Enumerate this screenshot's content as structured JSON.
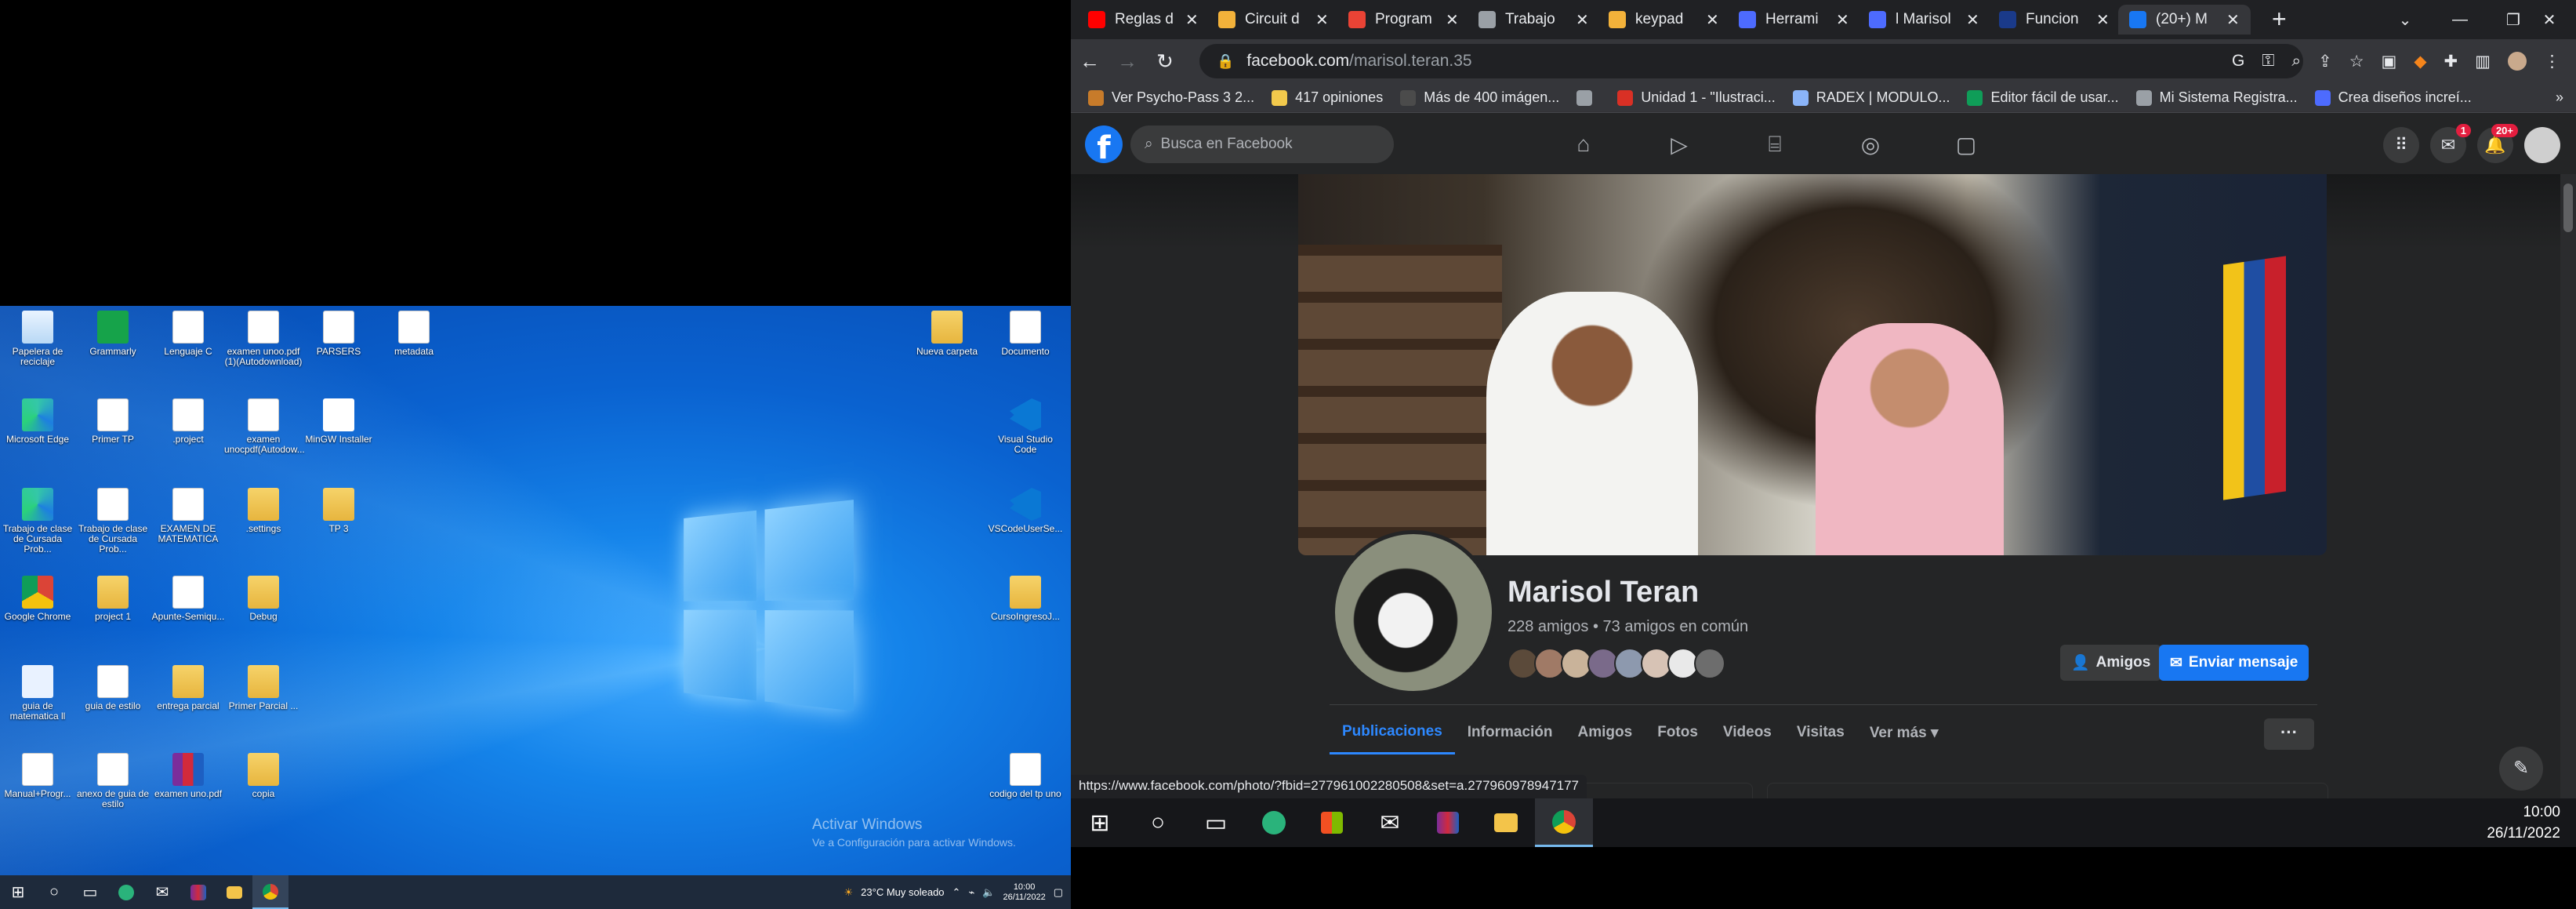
{
  "left_desktop": {
    "icons": [
      {
        "label": "Papelera de reciclaje",
        "kind": "recycle"
      },
      {
        "label": "Grammarly",
        "kind": "green"
      },
      {
        "label": "Lenguaje C",
        "kind": "file"
      },
      {
        "label": "examen unoo.pdf (1)(Autodownload)",
        "kind": "file"
      },
      {
        "label": "PARSERS",
        "kind": "file"
      },
      {
        "label": "metadata",
        "kind": "file"
      },
      {
        "label": "Microsoft Edge",
        "kind": "edge"
      },
      {
        "label": "Primer TP",
        "kind": "file"
      },
      {
        "label": ".project",
        "kind": "file"
      },
      {
        "label": "examen unocpdf(Autodow...",
        "kind": "file"
      },
      {
        "label": "MinGW Installer",
        "kind": "mingw"
      },
      {
        "label": "Trabajo de clase de Cursada Prob...",
        "kind": "edge"
      },
      {
        "label": "Trabajo de clase de Cursada Prob...",
        "kind": "file"
      },
      {
        "label": "EXAMEN DE MATEMATICA",
        "kind": "file"
      },
      {
        "label": ".settings",
        "kind": "folder"
      },
      {
        "label": "TP 3",
        "kind": "folder"
      },
      {
        "label": "Google Chrome",
        "kind": "chrome"
      },
      {
        "label": "project 1",
        "kind": "folder"
      },
      {
        "label": "Apunte-Semiqu...",
        "kind": "file"
      },
      {
        "label": "Debug",
        "kind": "folder"
      },
      {
        "label": "guia de matematica ll",
        "kind": "app"
      },
      {
        "label": "guia de estilo",
        "kind": "file"
      },
      {
        "label": "entrega parcial",
        "kind": "folder"
      },
      {
        "label": "Primer Parcial ...",
        "kind": "folder"
      },
      {
        "label": "Manual+Progr...",
        "kind": "file"
      },
      {
        "label": "anexo de guia de estilo",
        "kind": "file"
      },
      {
        "label": "examen uno.pdf",
        "kind": "rar"
      },
      {
        "label": "copia",
        "kind": "folder"
      },
      {
        "label": "Nueva carpeta",
        "kind": "folder"
      },
      {
        "label": "Documento",
        "kind": "file"
      },
      {
        "label": "Visual Studio Code",
        "kind": "vscode"
      },
      {
        "label": "VSCodeUserSe...",
        "kind": "vscode"
      },
      {
        "label": "CursoIngresoJ...",
        "kind": "folder"
      },
      {
        "label": "codigo del tp uno",
        "kind": "file"
      }
    ],
    "activate_title": "Activar Windows",
    "activate_sub": "Ve a Configuración para activar Windows."
  },
  "left_taskbar": {
    "weather": "23°C  Muy soleado",
    "time": "10:00",
    "date": "26/11/2022"
  },
  "browser": {
    "tabs": [
      {
        "title": "Reglas d",
        "color": "#ff0000"
      },
      {
        "title": "Circuit d",
        "color": "#f3b23a"
      },
      {
        "title": "Program",
        "color": "#ea4335"
      },
      {
        "title": "Trabajo",
        "color": "#9aa0a6"
      },
      {
        "title": "keypad",
        "color": "#f3b23a"
      },
      {
        "title": "Herrami",
        "color": "#4d6bfe"
      },
      {
        "title": "l Marisol",
        "color": "#4d6bfe"
      },
      {
        "title": "Funcion",
        "color": "#1a3a8a"
      },
      {
        "title": "(20+) M",
        "color": "#1877f2"
      }
    ],
    "new_tab_label": "+",
    "url_host": "facebook.com",
    "url_path": "/marisol.teran.35",
    "bookmarks": [
      {
        "label": "Ver Psycho-Pass 3 2...",
        "color": "#c77b2a"
      },
      {
        "label": "417 opiniones",
        "color": "#f2c94c"
      },
      {
        "label": "Más de 400 imágen...",
        "color": "#4b4b4b"
      },
      {
        "label": "",
        "color": "#9aa0a6"
      },
      {
        "label": "Unidad 1 - \"Ilustraci...",
        "color": "#d93025"
      },
      {
        "label": "RADEX | MODULO...",
        "color": "#8ab4f8"
      },
      {
        "label": "Editor fácil de usar...",
        "color": "#0f9d58"
      },
      {
        "label": "Mi Sistema Registra...",
        "color": "#9aa0a6"
      },
      {
        "label": "Crea diseños increí...",
        "color": "#4d6bfe"
      }
    ],
    "status_url": "https://www.facebook.com/photo/?fbid=277961002280508&set=a.277960978947177"
  },
  "facebook": {
    "logo": "f",
    "search_placeholder": "Busca en Facebook",
    "messenger_badge": "1",
    "notifications_badge": "20+",
    "profile_name": "Marisol Teran",
    "friends_text": "228 amigos • 73 amigos en común",
    "friends_button": "Amigos",
    "message_button": "Enviar mensaje",
    "tabs": [
      "Publicaciones",
      "Información",
      "Amigos",
      "Fotos",
      "Videos",
      "Visitas",
      "Ver más ▾"
    ],
    "more_dots": "···",
    "avatar_colors": [
      "#5b4a3a",
      "#a07a66",
      "#c9b39a",
      "#7a6a8a",
      "#8d99ae",
      "#d7c3b5",
      "#e9e9e9",
      "#6d6d6d"
    ]
  },
  "right_taskbar": {
    "time": "10:00",
    "date": "26/11/2022"
  }
}
